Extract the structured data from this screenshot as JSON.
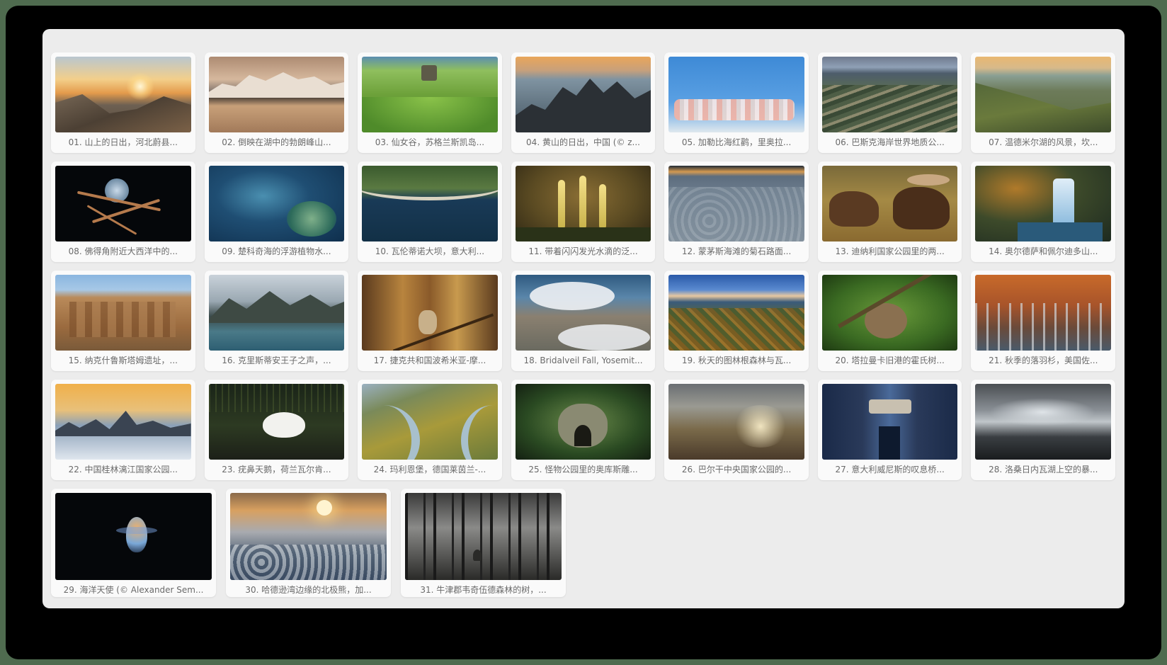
{
  "gallery": {
    "items": [
      {
        "caption": "01. 山上的日出，河北蔚县..."
      },
      {
        "caption": "02. 倒映在湖中的勃朗峰山..."
      },
      {
        "caption": "03. 仙女谷，苏格兰斯凯岛..."
      },
      {
        "caption": "04. 黄山的日出，中国 (© z..."
      },
      {
        "caption": "05. 加勒比海红鹳，里奥拉..."
      },
      {
        "caption": "06. 巴斯克海岸世界地质公..."
      },
      {
        "caption": "07. 温德米尔湖的风景，坎..."
      },
      {
        "caption": "08. 佛得角附近大西洋中的..."
      },
      {
        "caption": "09. 楚科奇海的浮游植物水..."
      },
      {
        "caption": "10. 瓦伦蒂诺大坝，意大利..."
      },
      {
        "caption": "11. 带着闪闪发光水滴的泛..."
      },
      {
        "caption": "12. 蒙茅斯海滩的菊石路面..."
      },
      {
        "caption": "13. 迪纳利国家公园里的两..."
      },
      {
        "caption": "14. 奥尔德萨和佩尔迪多山..."
      },
      {
        "caption": "15. 纳克什鲁斯塔姆遗址，..."
      },
      {
        "caption": "16. 克里斯蒂安王子之声，..."
      },
      {
        "caption": "17. 捷克共和国波希米亚-摩..."
      },
      {
        "caption": "18. Bridalveil Fall, Yosemit..."
      },
      {
        "caption": "19. 秋天的图林根森林与瓦..."
      },
      {
        "caption": "20. 塔拉曼卡旧港的霍氏树..."
      },
      {
        "caption": "21. 秋季的落羽杉，美国佐..."
      },
      {
        "caption": "22. 中国桂林漓江国家公园..."
      },
      {
        "caption": "23. 疣鼻天鹅，荷兰瓦尔肯..."
      },
      {
        "caption": "24. 玛利恩堡，德国莱茵兰-..."
      },
      {
        "caption": "25. 怪物公园里的奥库斯雕..."
      },
      {
        "caption": "26. 巴尔干中央国家公园的..."
      },
      {
        "caption": "27. 意大利威尼斯的叹息桥..."
      },
      {
        "caption": "28. 洛桑日内瓦湖上空的暴..."
      },
      {
        "caption": "29. 海洋天使 (© Alexander Sem..."
      },
      {
        "caption": "30. 哈德逊湾边缘的北极熊，加..."
      },
      {
        "caption": "31. 牛津郡韦奇伍德森林的树，..."
      }
    ]
  }
}
